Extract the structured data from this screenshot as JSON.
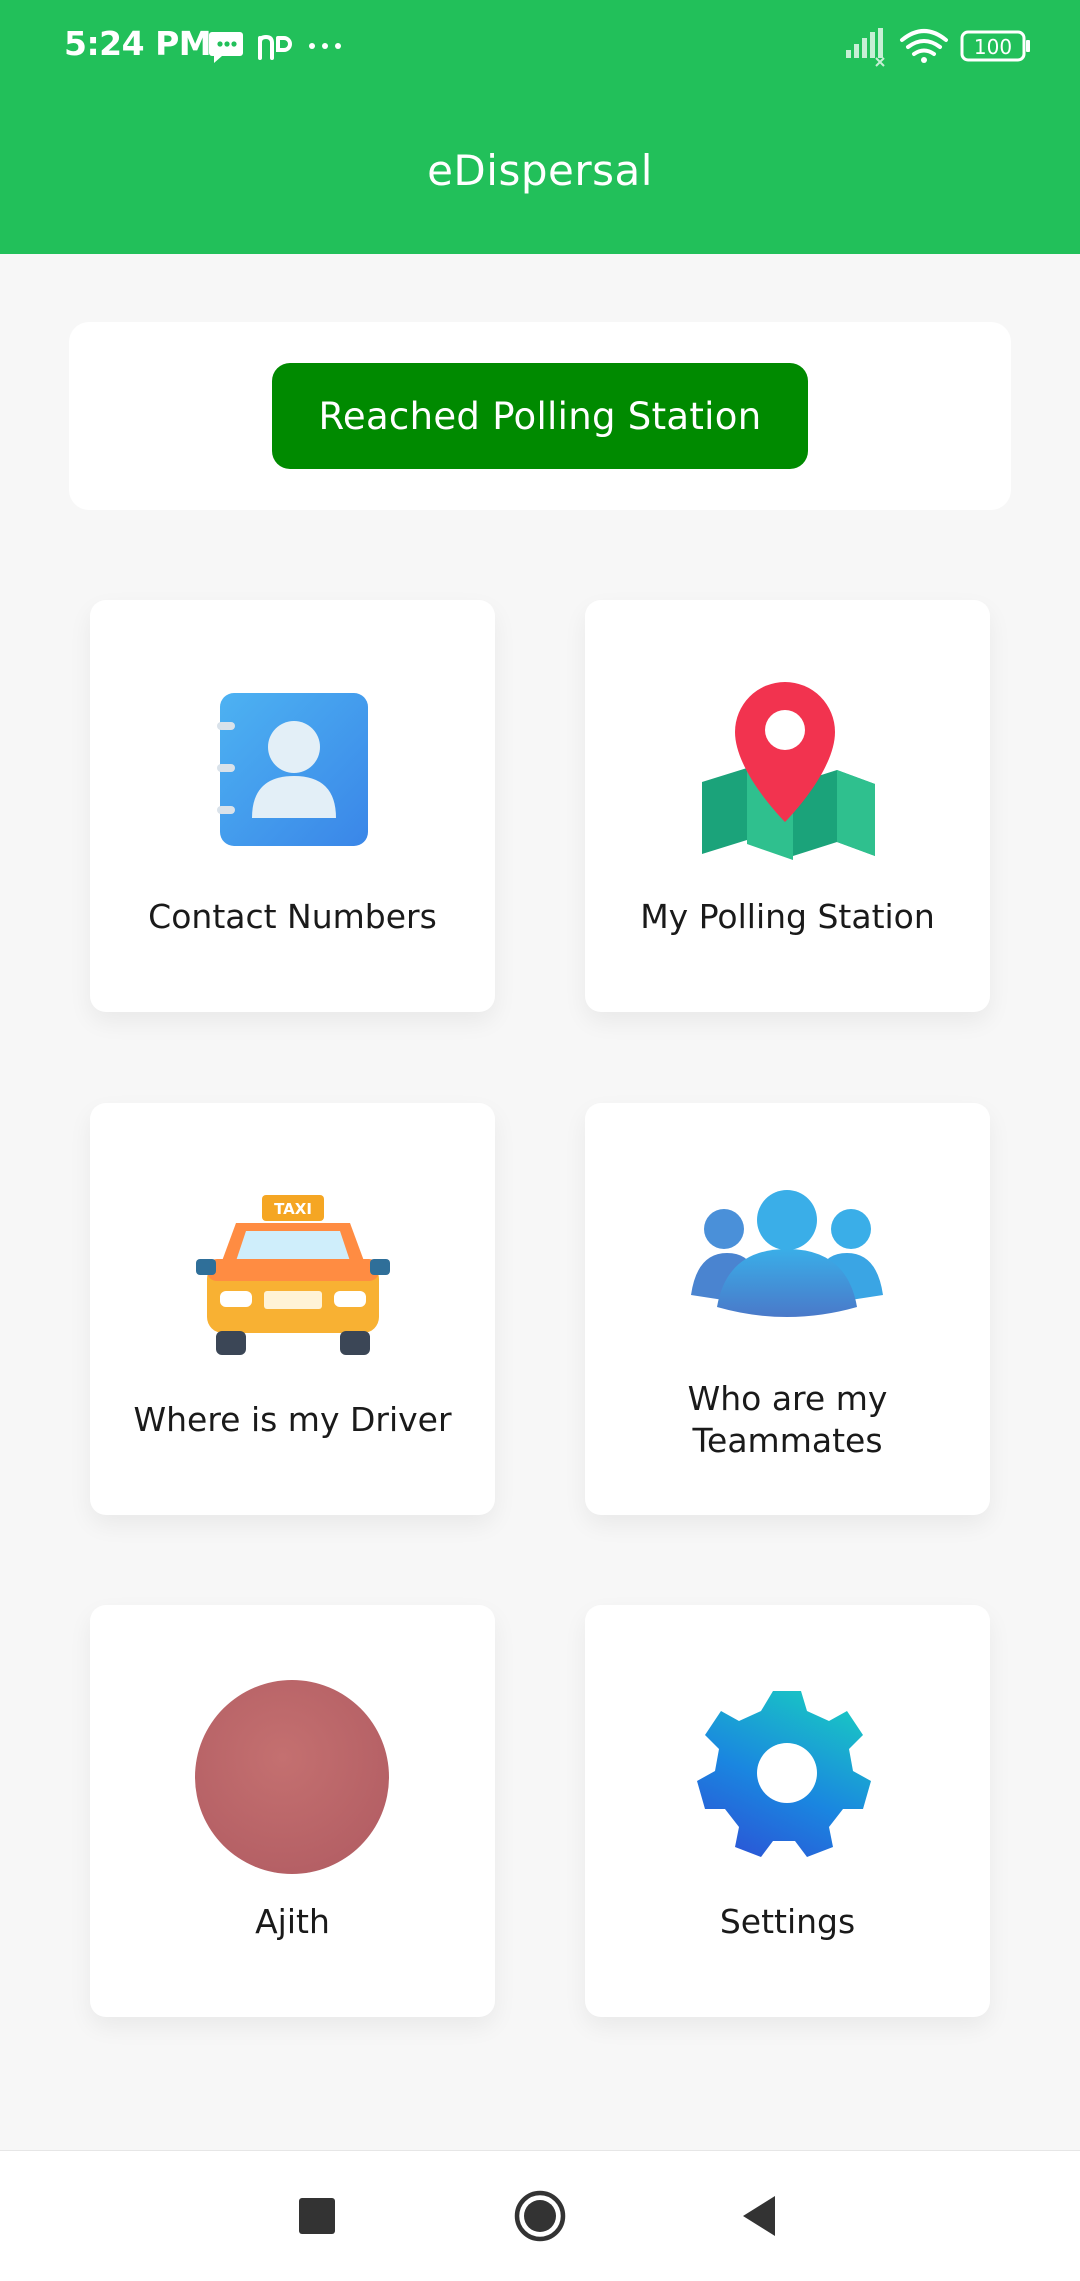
{
  "status_bar": {
    "time": "5:24 PM",
    "battery": "100",
    "icons": [
      "message-icon",
      "np-app-icon",
      "more-dots-icon",
      "signal-icon",
      "wifi-icon",
      "battery-icon"
    ]
  },
  "app": {
    "title": "eDispersal"
  },
  "reach_button": {
    "label": "Reached Polling Station"
  },
  "tiles": [
    {
      "label": "Contact Numbers",
      "icon": "contact-book-icon"
    },
    {
      "label": "My Polling Station",
      "icon": "map-pin-icon"
    },
    {
      "label": "Where is my Driver",
      "icon": "taxi-icon"
    },
    {
      "label_lines": [
        "Who are my",
        "Teammates"
      ],
      "icon": "team-icon"
    },
    {
      "label": "Ajith",
      "icon": "avatar"
    },
    {
      "label": "Settings",
      "icon": "gear-icon"
    }
  ],
  "taxi_sign": "TAXI",
  "nav_bar": {
    "icons": [
      "recent-apps-icon",
      "home-icon",
      "back-icon"
    ]
  },
  "colors": {
    "header": "#22c05a",
    "primary_button": "#008a00",
    "background": "#f7f7f7"
  }
}
